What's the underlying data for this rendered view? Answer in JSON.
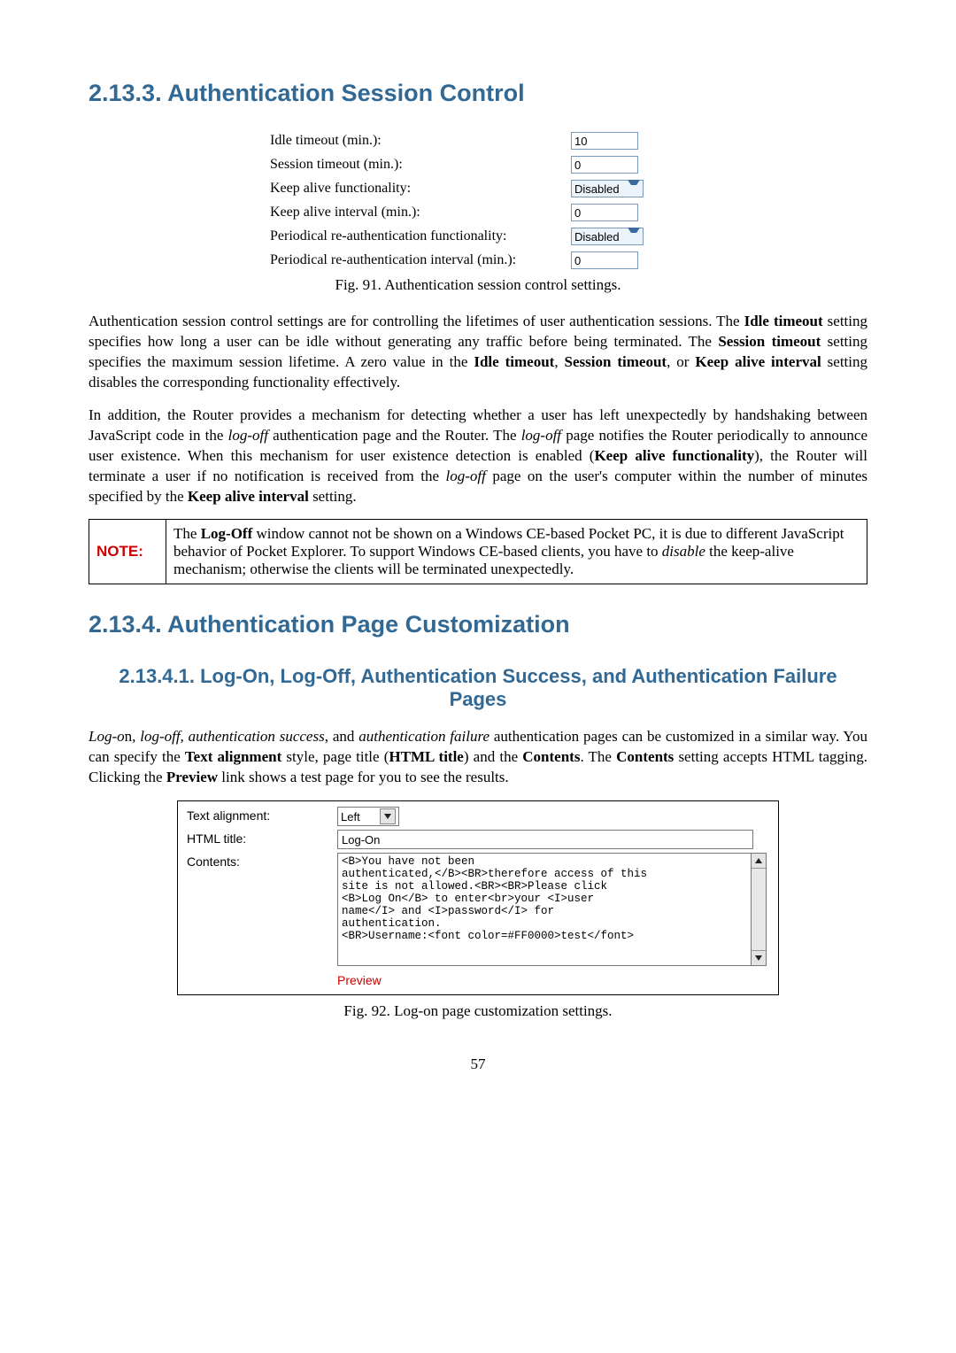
{
  "h1a": "2.13.3. Authentication Session Control",
  "fig91": {
    "rows": [
      {
        "label": "Idle timeout (min.):",
        "type": "input",
        "value": "10"
      },
      {
        "label": "Session timeout (min.):",
        "type": "input",
        "value": "0"
      },
      {
        "label": "Keep alive functionality:",
        "type": "select",
        "value": "Disabled"
      },
      {
        "label": "Keep alive interval (min.):",
        "type": "input",
        "value": "0"
      },
      {
        "label": "Periodical re-authentication functionality:",
        "type": "select",
        "value": "Disabled"
      },
      {
        "label": "Periodical re-authentication interval (min.):",
        "type": "input",
        "value": "0"
      }
    ],
    "caption": "Fig. 91. Authentication session control settings."
  },
  "para1_parts": {
    "a": "Authentication session control settings are for controlling the lifetimes of user authentication sessions. The ",
    "b": "Idle timeout",
    "c": " setting specifies how long a user can be idle without generating any traffic before being terminated. The ",
    "d": "Session timeout",
    "e": " setting specifies the maximum session lifetime. A zero value in the ",
    "f": "Idle timeout",
    "g": ", ",
    "h": "Session timeout",
    "i": ", or ",
    "j": "Keep alive interval",
    "k": " setting disables the corresponding functionality effectively."
  },
  "para2_parts": {
    "a": "In addition, the Router provides a mechanism for detecting whether a user has left unexpectedly by handshaking between JavaScript code in the ",
    "b": "log-off",
    "c": " authentication page and the Router. The ",
    "d": "log-off",
    "e": " page notifies the Router periodically to announce user existence. When this mechanism for user existence detection is enabled (",
    "f": "Keep alive functionality",
    "g": "), the Router will terminate a user if no notification is received from the ",
    "h": "log-off",
    "i": " page on the user's computer within the number of minutes specified by the ",
    "j": "Keep alive interval",
    "k": " setting."
  },
  "note": {
    "label": "NOTE:",
    "a": "The ",
    "b": "Log-Off",
    "c": " window cannot not be shown on a Windows CE-based Pocket PC, it is due to different JavaScript behavior of Pocket Explorer. To support Windows CE-based clients, you have to ",
    "d": "disable",
    "e": " the keep-alive mechanism; otherwise the clients will be terminated unexpectedly."
  },
  "h1b": "2.13.4. Authentication Page Customization",
  "h2a": "2.13.4.1. Log-On, Log-Off, Authentication Success, and Authentication Failure Pages",
  "para3_parts": {
    "a": "Log-o",
    "a2": "n",
    "b": ", log-off, authentication success",
    "c": ", and ",
    "d": "authentication failure",
    "e": " authentication pages can be customized in a similar way. You can specify the ",
    "f": "Text alignment",
    "g": " style, page title (",
    "h": "HTML title",
    "i": ") and the ",
    "j": "Contents",
    "k": ". The ",
    "l": "Contents",
    "m": " setting accepts HTML tagging. Clicking the ",
    "n": "Preview",
    "o": " link shows a test page for you to see the results."
  },
  "fig92": {
    "labels": {
      "align": "Text alignment:",
      "title": "HTML title:",
      "contents": "Contents:"
    },
    "align_value": "Left",
    "title_value": "Log-On",
    "contents_value": "<B>You have not been\nauthenticated,</B><BR>therefore access of this\nsite is not allowed.<BR><BR>Please click\n<B>Log On</B> to enter<br>your <I>user\nname</I> and <I>password</I> for\nauthentication.\n<BR>Username:<font color=#FF0000>test</font>",
    "preview": "Preview",
    "caption": "Fig. 92. Log-on page customization settings."
  },
  "page_num": "57"
}
